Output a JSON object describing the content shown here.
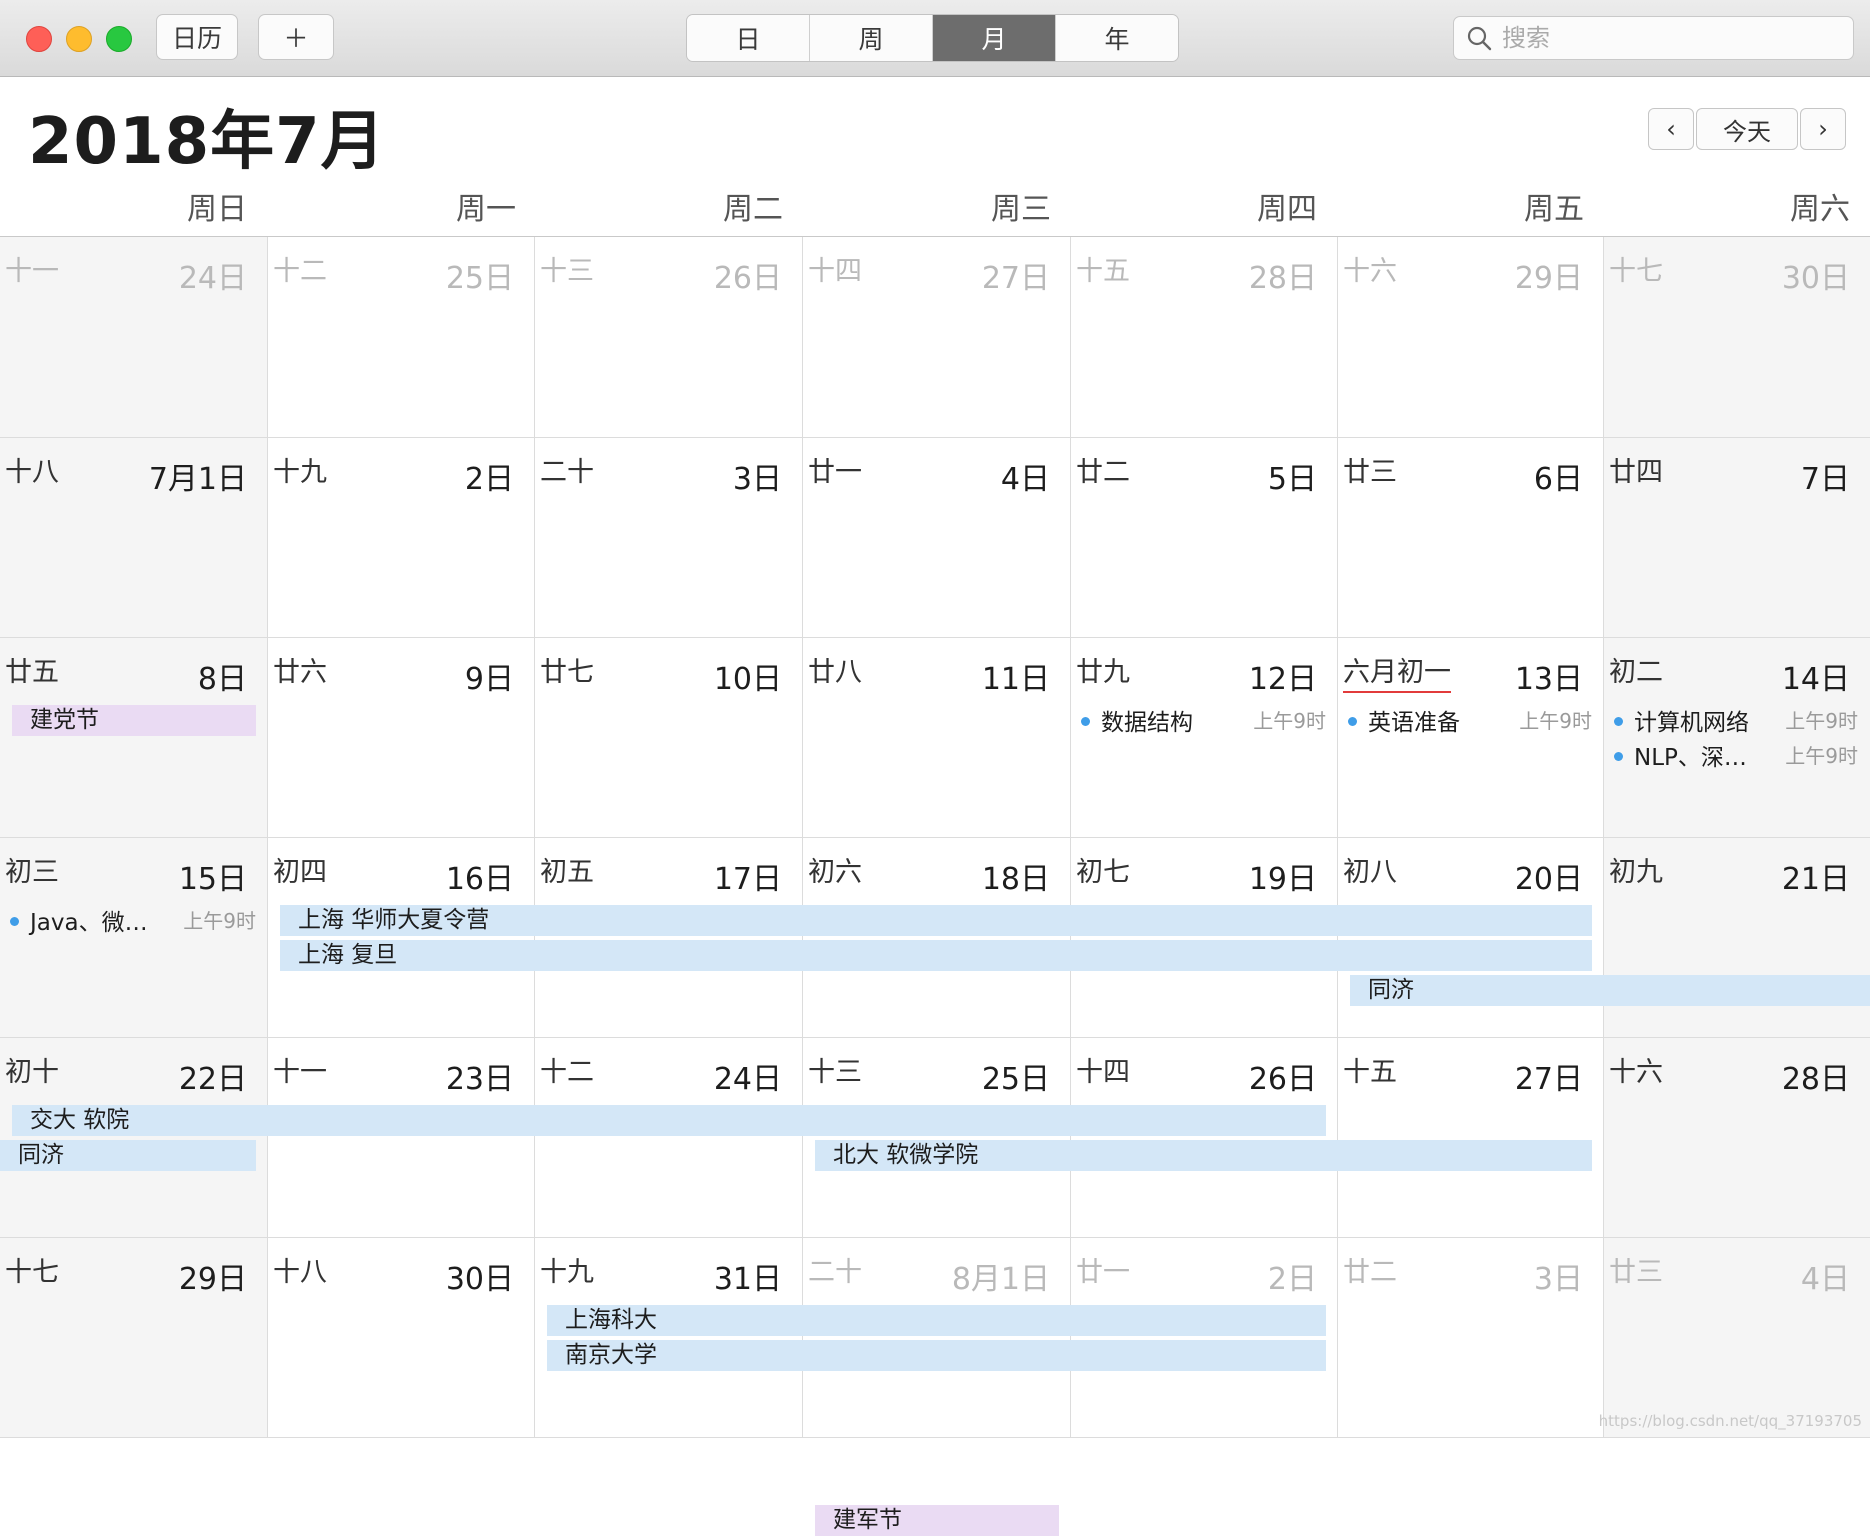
{
  "toolbar": {
    "calendars_label": "日历",
    "add_label": "＋",
    "views": [
      {
        "label": "日",
        "active": false
      },
      {
        "label": "周",
        "active": false
      },
      {
        "label": "月",
        "active": true
      },
      {
        "label": "年",
        "active": false
      }
    ],
    "search_placeholder": "搜索"
  },
  "header": {
    "month_title": "2018年7月",
    "prev_label": "‹",
    "today_label": "今天",
    "next_label": "›"
  },
  "weekdays": [
    "周日",
    "周一",
    "周二",
    "周三",
    "周四",
    "周五",
    "周六"
  ],
  "weeks": [
    [
      {
        "lunar": "十一",
        "day": "24日",
        "other": true
      },
      {
        "lunar": "十二",
        "day": "25日",
        "other": true
      },
      {
        "lunar": "十三",
        "day": "26日",
        "other": true
      },
      {
        "lunar": "十四",
        "day": "27日",
        "other": true
      },
      {
        "lunar": "十五",
        "day": "28日",
        "other": true
      },
      {
        "lunar": "十六",
        "day": "29日",
        "other": true
      },
      {
        "lunar": "十七",
        "day": "30日",
        "other": true
      }
    ],
    [
      {
        "lunar": "十八",
        "day": "7月1日"
      },
      {
        "lunar": "十九",
        "day": "2日"
      },
      {
        "lunar": "二十",
        "day": "3日"
      },
      {
        "lunar": "廿一",
        "day": "4日"
      },
      {
        "lunar": "廿二",
        "day": "5日"
      },
      {
        "lunar": "廿三",
        "day": "6日"
      },
      {
        "lunar": "廿四",
        "day": "7日"
      }
    ],
    [
      {
        "lunar": "廿五",
        "day": "8日"
      },
      {
        "lunar": "廿六",
        "day": "9日"
      },
      {
        "lunar": "廿七",
        "day": "10日"
      },
      {
        "lunar": "廿八",
        "day": "11日"
      },
      {
        "lunar": "廿九",
        "day": "12日"
      },
      {
        "lunar": "六月初一",
        "day": "13日",
        "new_month": true
      },
      {
        "lunar": "初二",
        "day": "14日"
      }
    ],
    [
      {
        "lunar": "初三",
        "day": "15日"
      },
      {
        "lunar": "初四",
        "day": "16日"
      },
      {
        "lunar": "初五",
        "day": "17日"
      },
      {
        "lunar": "初六",
        "day": "18日"
      },
      {
        "lunar": "初七",
        "day": "19日"
      },
      {
        "lunar": "初八",
        "day": "20日"
      },
      {
        "lunar": "初九",
        "day": "21日"
      }
    ],
    [
      {
        "lunar": "初十",
        "day": "22日"
      },
      {
        "lunar": "十一",
        "day": "23日"
      },
      {
        "lunar": "十二",
        "day": "24日"
      },
      {
        "lunar": "十三",
        "day": "25日"
      },
      {
        "lunar": "十四",
        "day": "26日"
      },
      {
        "lunar": "十五",
        "day": "27日"
      },
      {
        "lunar": "十六",
        "day": "28日"
      }
    ],
    [
      {
        "lunar": "十七",
        "day": "29日"
      },
      {
        "lunar": "十八",
        "day": "30日"
      },
      {
        "lunar": "十九",
        "day": "31日"
      },
      {
        "lunar": "二十",
        "day": "8月1日",
        "other": true
      },
      {
        "lunar": "廿一",
        "day": "2日",
        "other": true
      },
      {
        "lunar": "廿二",
        "day": "3日",
        "other": true
      },
      {
        "lunar": "廿三",
        "day": "4日",
        "other": true
      }
    ]
  ],
  "all_day_events": [
    {
      "title": "建党节",
      "week": 1,
      "start": 0,
      "end": 0,
      "lane": 0,
      "color": "purple"
    },
    {
      "title": "上海 华师大夏令营",
      "week": 2,
      "start": 1,
      "end": 5,
      "lane": 0,
      "color": "blue"
    },
    {
      "title": "上海 复旦",
      "week": 2,
      "start": 1,
      "end": 5,
      "lane": 1,
      "color": "blue"
    },
    {
      "title": "同济",
      "week": 2,
      "start": 5,
      "end": 6,
      "lane": 2,
      "color": "blue",
      "cont_right": true
    },
    {
      "title": "交大 软院",
      "week": 3,
      "start": 0,
      "end": 4,
      "lane": 0,
      "color": "blue"
    },
    {
      "title": "同济",
      "week": 3,
      "start": 0,
      "end": 0,
      "lane": 1,
      "color": "blue",
      "cont_left": true
    },
    {
      "title": "北大 软微学院",
      "week": 3,
      "start": 3,
      "end": 5,
      "lane": 1,
      "color": "blue"
    },
    {
      "title": "上海科大",
      "week": 4,
      "start": 2,
      "end": 4,
      "lane": 0,
      "color": "blue"
    },
    {
      "title": "南京大学",
      "week": 4,
      "start": 2,
      "end": 4,
      "lane": 1,
      "color": "blue"
    },
    {
      "title": "建军节",
      "week": 5,
      "start": 3,
      "end": 3,
      "lane": 0,
      "color": "purple"
    }
  ],
  "timed_events": [
    {
      "title": "数据结构",
      "time": "上午9时",
      "week": 1,
      "day": 4,
      "lane": 0
    },
    {
      "title": "英语准备",
      "time": "上午9时",
      "week": 1,
      "day": 5,
      "lane": 0
    },
    {
      "title": "计算机网络",
      "time": "上午9时",
      "week": 1,
      "day": 6,
      "lane": 0
    },
    {
      "title": "NLP、深…",
      "time": "上午9时",
      "week": 1,
      "day": 6,
      "lane": 1
    },
    {
      "title": "Java、微…",
      "time": "上午9时",
      "week": 2,
      "day": 0,
      "lane": 0
    }
  ],
  "colors": {
    "event_blue": "#d4e7f7",
    "event_purple": "#eadbf3",
    "dot": "#3f9de8"
  },
  "watermark": "https://blog.csdn.net/qq_37193705"
}
